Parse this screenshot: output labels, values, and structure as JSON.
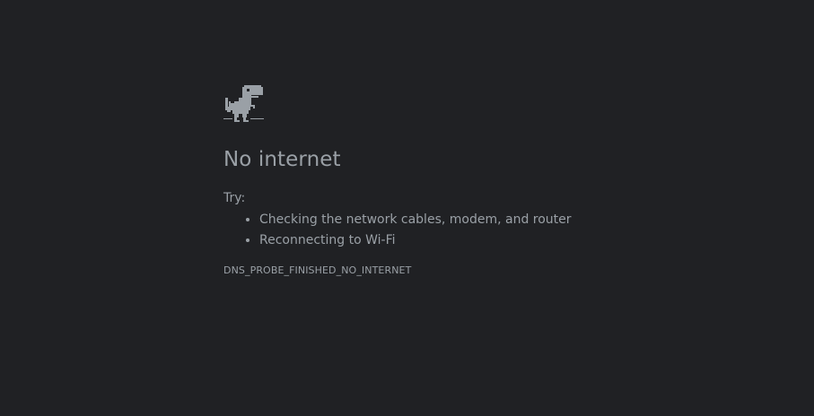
{
  "page": {
    "background": "#202124",
    "text_color": "#9aa0a6"
  },
  "icon": {
    "name": "offline-dino-icon"
  },
  "error": {
    "title": "No internet",
    "try_label": "Try:",
    "suggestions": [
      "Checking the network cables, modem, and router",
      "Reconnecting to Wi-Fi"
    ],
    "code": "DNS_PROBE_FINISHED_NO_INTERNET"
  }
}
